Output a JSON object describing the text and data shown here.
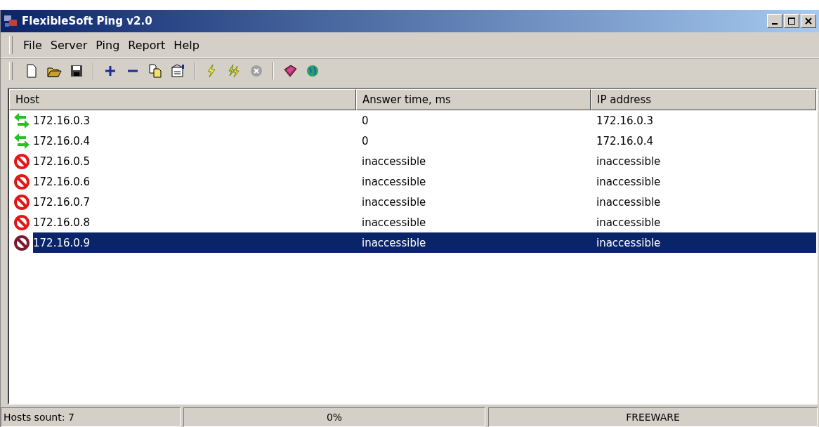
{
  "window": {
    "title": "FlexibleSoft Ping v2.0"
  },
  "menu": [
    "File",
    "Server",
    "Ping",
    "Report",
    "Help"
  ],
  "table": {
    "columns": [
      "Host",
      "Answer time, ms",
      "IP address"
    ],
    "rows": [
      {
        "kind": "ok",
        "host": "172.16.0.3",
        "answer_time": "0",
        "ip": "172.16.0.3",
        "selected": false
      },
      {
        "kind": "ok",
        "host": "172.16.0.4",
        "answer_time": "0",
        "ip": "172.16.0.4",
        "selected": false
      },
      {
        "kind": "fail",
        "host": "172.16.0.5",
        "answer_time": "inaccessible",
        "ip": "inaccessible",
        "selected": false
      },
      {
        "kind": "fail",
        "host": "172.16.0.6",
        "answer_time": "inaccessible",
        "ip": "inaccessible",
        "selected": false
      },
      {
        "kind": "fail",
        "host": "172.16.0.7",
        "answer_time": "inaccessible",
        "ip": "inaccessible",
        "selected": false
      },
      {
        "kind": "fail",
        "host": "172.16.0.8",
        "answer_time": "inaccessible",
        "ip": "inaccessible",
        "selected": false
      },
      {
        "kind": "fail",
        "host": "172.16.0.9",
        "answer_time": "inaccessible",
        "ip": "inaccessible",
        "selected": true
      }
    ]
  },
  "status_bar": [
    "Hosts sount: 7",
    "0%",
    "FREEWARE"
  ]
}
